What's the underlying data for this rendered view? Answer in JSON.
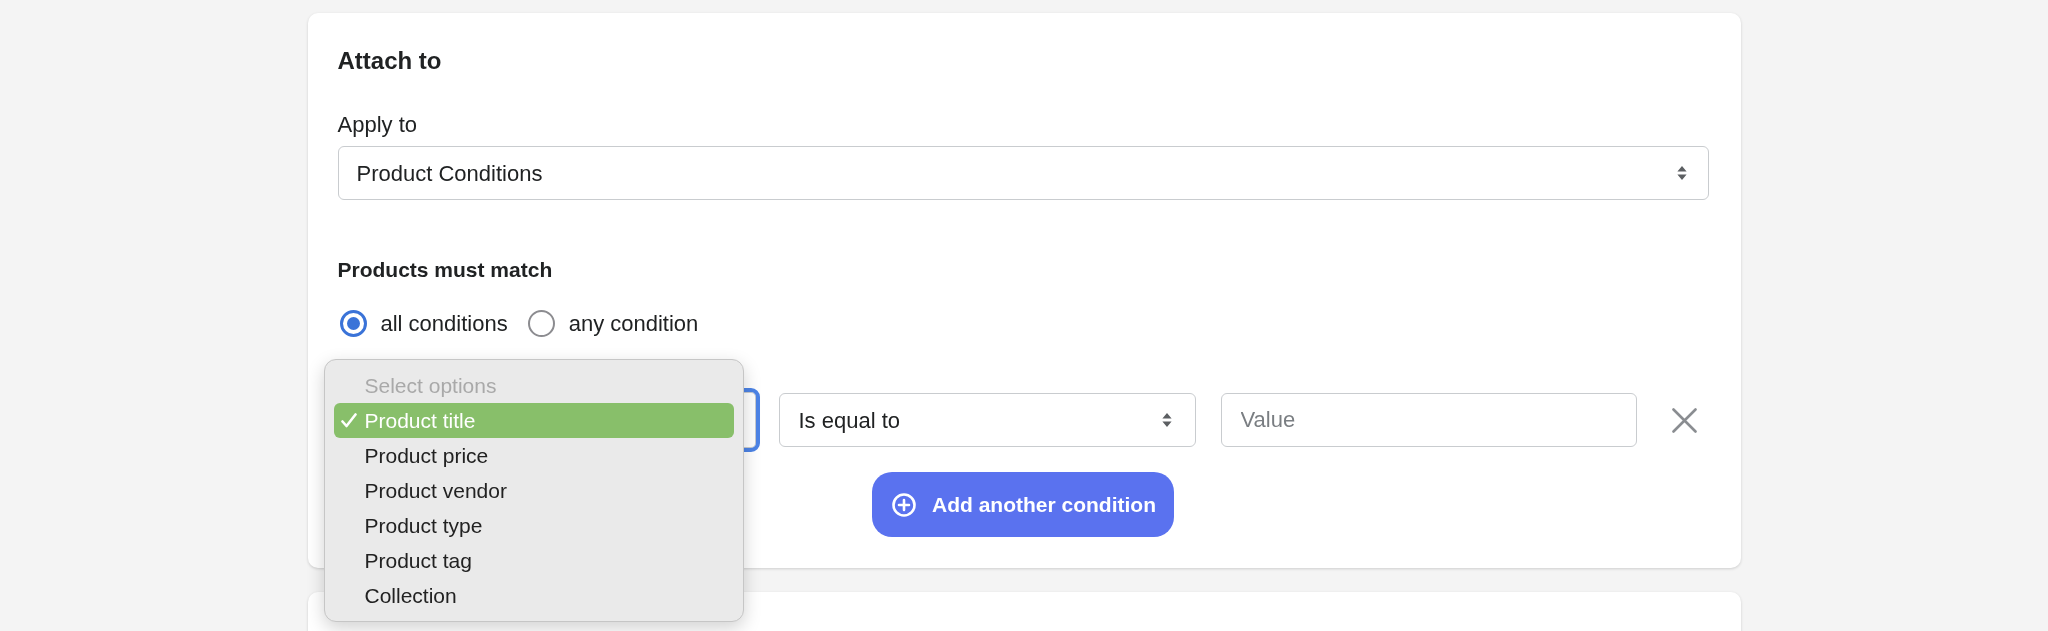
{
  "card": {
    "title": "Attach to",
    "apply_to": {
      "label": "Apply to",
      "value": "Product Conditions"
    },
    "match": {
      "label": "Products must match",
      "options": [
        {
          "label": "all conditions",
          "selected": true
        },
        {
          "label": "any condition",
          "selected": false
        }
      ]
    },
    "conditions": [
      {
        "field": {
          "focused": true,
          "menu": {
            "options": [
              {
                "label": "Select options",
                "disabled": true,
                "selected": false
              },
              {
                "label": "Product title",
                "disabled": false,
                "selected": true
              },
              {
                "label": "Product price",
                "disabled": false,
                "selected": false
              },
              {
                "label": "Product vendor",
                "disabled": false,
                "selected": false
              },
              {
                "label": "Product type",
                "disabled": false,
                "selected": false
              },
              {
                "label": "Product tag",
                "disabled": false,
                "selected": false
              },
              {
                "label": "Collection",
                "disabled": false,
                "selected": false
              }
            ]
          }
        },
        "operator": "Is equal to",
        "value": {
          "placeholder": "Value"
        }
      }
    ],
    "add_button": "Add another condition"
  }
}
